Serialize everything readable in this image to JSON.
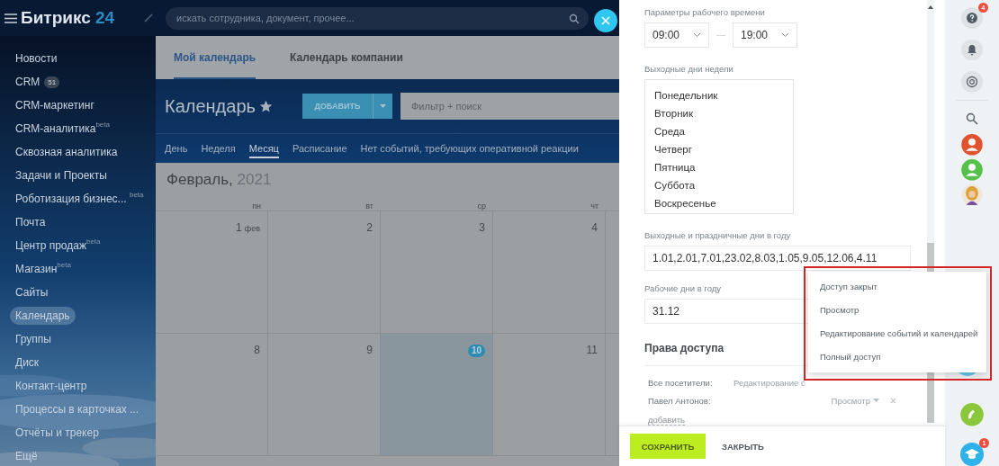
{
  "topbar": {
    "logo": "Битрикс",
    "logo_number": "24",
    "search": {
      "placeholder": "искать сотрудника, документ, прочее..."
    }
  },
  "sidebar": {
    "items": [
      {
        "label": "Новости",
        "selected": false
      },
      {
        "label": "CRM",
        "badge": "51",
        "selected": false
      },
      {
        "label": "CRM-маркетинг",
        "selected": false
      },
      {
        "label": "CRM-аналитика$^{beta}$",
        "selected": false
      },
      {
        "label": "Сквозная аналитика",
        "selected": false
      },
      {
        "label": "Задачи и Проекты",
        "selected": false
      },
      {
        "label": "Роботизация бизнес... $^{beta}$",
        "selected": false
      },
      {
        "label": "Почта",
        "selected": false
      },
      {
        "label": "Центр продаж$^{beta}$",
        "selected": false
      },
      {
        "label": "Магазин$^{beta}$",
        "selected": false
      },
      {
        "label": "Сайты",
        "selected": false
      },
      {
        "label": "Календарь",
        "selected": true
      },
      {
        "label": "Группы",
        "selected": false
      },
      {
        "label": "Диск",
        "selected": false
      },
      {
        "label": "Контакт-центр",
        "selected": false
      },
      {
        "label": "Процессы в карточках ...",
        "selected": false
      },
      {
        "label": "Отчёты и трекер",
        "selected": false
      },
      {
        "label": "Ещё",
        "selected": false
      }
    ]
  },
  "calendar": {
    "tabs": [
      {
        "label": "Мой календарь",
        "selected": true
      },
      {
        "label": "Календарь компании",
        "selected": false
      }
    ],
    "title": "Календарь",
    "add_button": "ДОБАВИТЬ",
    "filter": {
      "placeholder": "Фильтр + поиск"
    },
    "views": [
      {
        "label": "День",
        "selected": false
      },
      {
        "label": "Неделя",
        "selected": false
      },
      {
        "label": "Месяц",
        "selected": true
      },
      {
        "label": "Расписание",
        "selected": false
      }
    ],
    "notice": "Нет событий, требующих оперативной реакции",
    "month": "Февраль,",
    "year": "2021",
    "weekdays": [
      "пн",
      "вт",
      "ср",
      "чт"
    ],
    "weeks": [
      [
        {
          "day": "1",
          "month": "фев",
          "today": false
        },
        {
          "day": "2",
          "today": false
        },
        {
          "day": "3",
          "today": false
        },
        {
          "day": "4",
          "today": false
        }
      ],
      [
        {
          "day": "8",
          "today": false
        },
        {
          "day": "9",
          "today": false
        },
        {
          "day": "10",
          "today": true
        },
        {
          "day": "11",
          "today": false
        }
      ]
    ]
  },
  "panel": {
    "work_hours_label": "Параметры рабочего времени",
    "start": "09:00",
    "end": "19:00",
    "weekend_label": "Выходные дни недели",
    "weekdays": [
      "Понедельник",
      "Вторник",
      "Среда",
      "Четверг",
      "Пятница",
      "Суббота",
      "Воскресенье"
    ],
    "holidays_label": "Выходные и праздничные дни в году",
    "holidays": "1.01,2.01,7.01,23.02,8.03,1.05,9.05,12.06,4.11",
    "workdays_label": "Рабочие дни в году",
    "workdays": "31.12",
    "access_title": "Права доступа",
    "access": [
      {
        "name": "Все посетители:",
        "level": "Редактирование с",
        "removable": false
      },
      {
        "name": "Павел Антонов:",
        "level": "Просмотр",
        "removable": true
      }
    ],
    "add_link": "добавить",
    "menu": [
      "Доступ закрыт",
      "Просмотр",
      "Редактирование событий и календарей",
      "Полный доступ"
    ],
    "save_button": "СОХРАНИТЬ",
    "close_button": "ЗАКРЫТЬ"
  },
  "rightbar": {
    "help_badge": "4",
    "learn_badge": "1"
  }
}
